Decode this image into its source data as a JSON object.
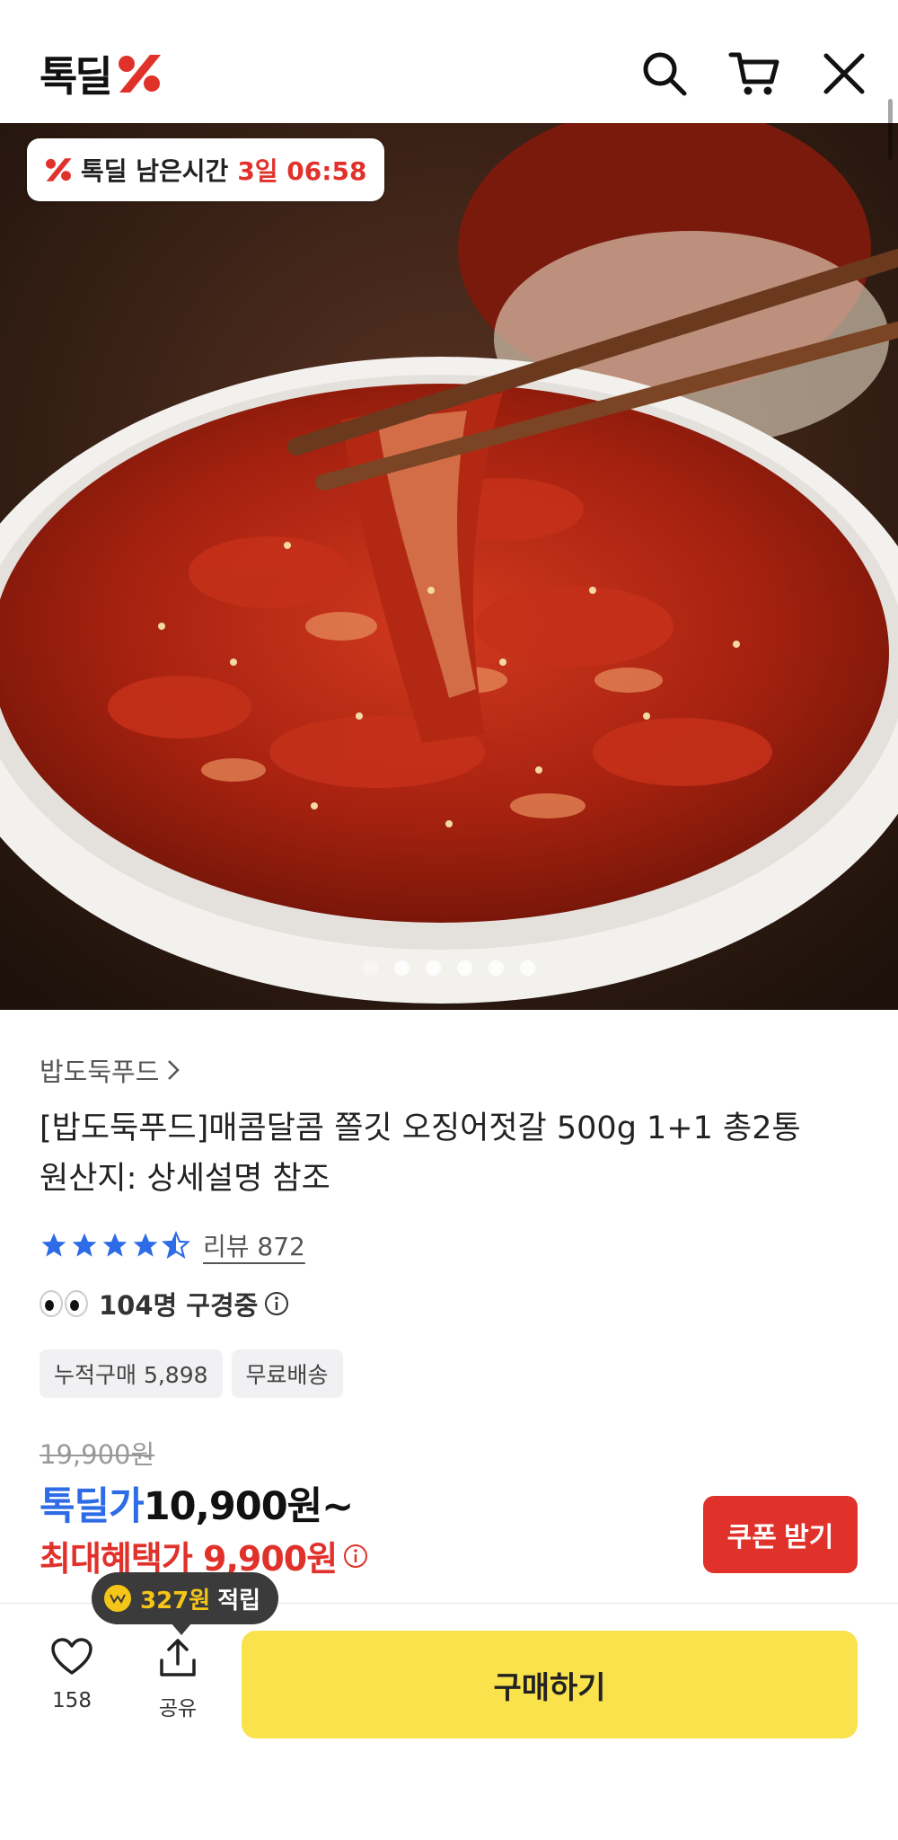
{
  "header": {
    "logo_text": "톡딜",
    "icons": [
      "search-icon",
      "cart-icon",
      "close-icon"
    ]
  },
  "hero": {
    "timer_label": "톡딜 남은시간",
    "timer_value": "3일 06:58",
    "slide_count": 6,
    "active_slide": 1
  },
  "product": {
    "seller": "밥도둑푸드",
    "title_line1": "[밥도둑푸드]매콤달콤 쫄깃 오징어젓갈 500g 1+1 총2통",
    "title_line2": "원산지: 상세설명 참조",
    "rating": 4.5,
    "review_label": "리뷰 872",
    "viewers": "104명 구경중",
    "tags": [
      "누적구매 5,898",
      "무료배송"
    ]
  },
  "price": {
    "original": "19,900원",
    "deal_label": "톡딜가",
    "deal_value": "10,900원~",
    "max_benefit": "최대혜택가 9,900원",
    "coupon_button": "쿠폰 받기"
  },
  "bottom": {
    "points_amount": "327원",
    "points_label": "적립",
    "like_count": "158",
    "share_label": "공유",
    "buy_button": "구매하기"
  },
  "colors": {
    "accent_red": "#e0322b",
    "deal_blue": "#2e6be6",
    "buy_yellow": "#fae24c",
    "star_blue": "#2e6be6"
  }
}
